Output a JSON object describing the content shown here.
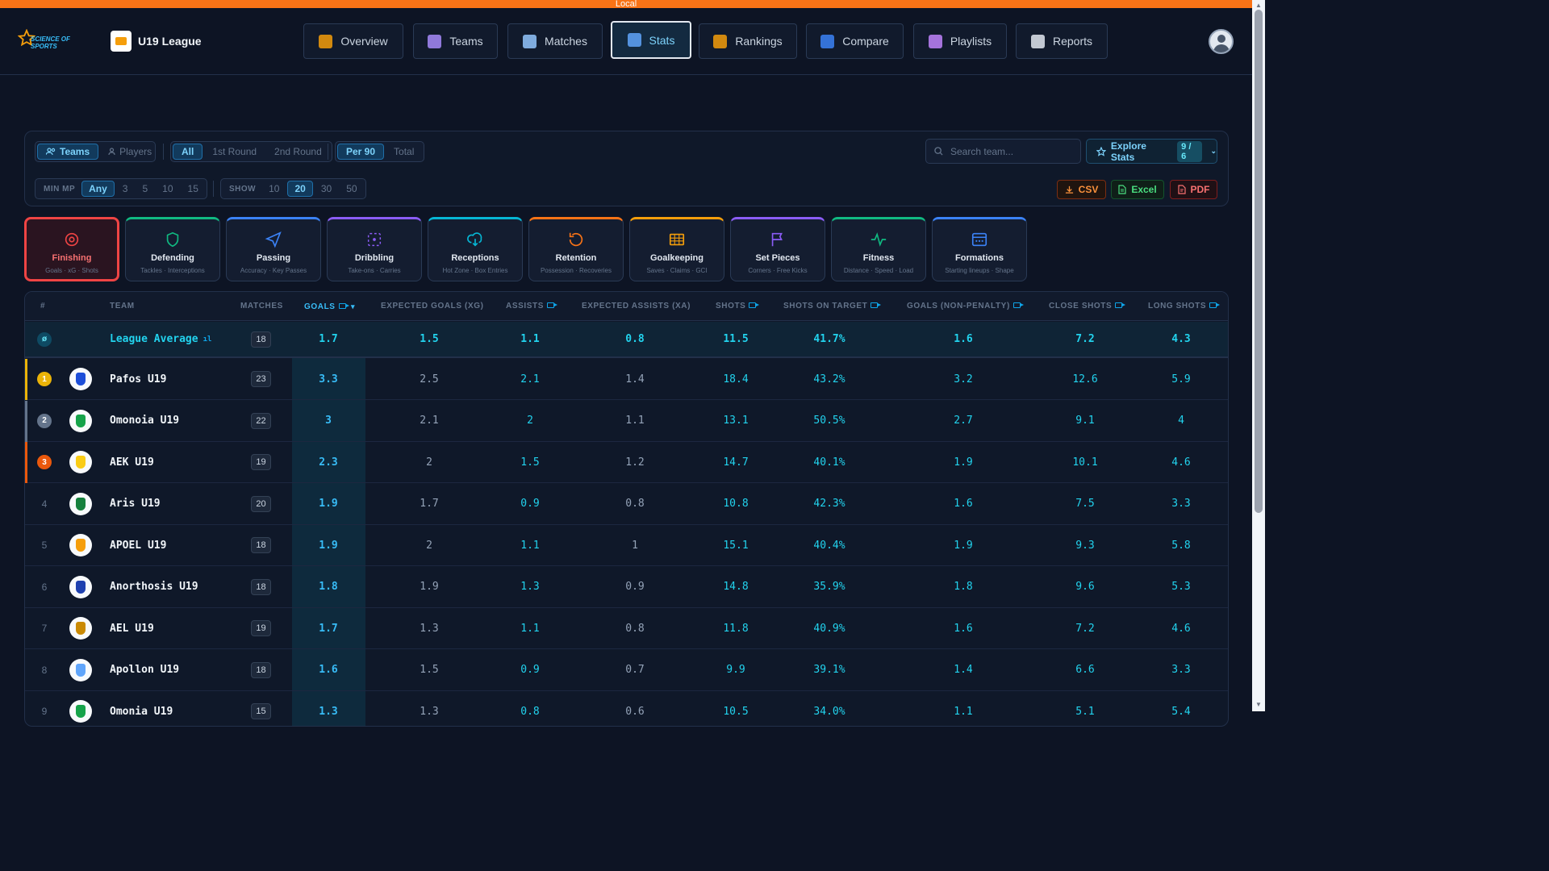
{
  "env_label": "Local",
  "brand": {
    "name": "SCIENCE OF SPORTS"
  },
  "league": {
    "name": "U19 League"
  },
  "nav": [
    {
      "label": "Overview",
      "icon": "chart-icon",
      "color": "#f59e0b"
    },
    {
      "label": "Teams",
      "icon": "users-icon",
      "color": "#a78bfa"
    },
    {
      "label": "Matches",
      "icon": "calendar-icon",
      "color": "#93c5fd"
    },
    {
      "label": "Stats",
      "icon": "trending-icon",
      "color": "#60a5fa",
      "active": true
    },
    {
      "label": "Rankings",
      "icon": "trophy-icon",
      "color": "#f59e0b"
    },
    {
      "label": "Compare",
      "icon": "compare-icon",
      "color": "#3b82f6"
    },
    {
      "label": "Playlists",
      "icon": "video-group-icon",
      "color": "#c084fc"
    },
    {
      "label": "Reports",
      "icon": "document-icon",
      "color": "#e2e8f0"
    }
  ],
  "filters": {
    "entity": [
      "Teams",
      "Players"
    ],
    "round": [
      "All",
      "1st Round",
      "2nd Round"
    ],
    "mode": [
      "Per 90",
      "Total"
    ],
    "min_mp_label": "MIN MP",
    "min_mp": [
      "Any",
      "3",
      "5",
      "10",
      "15"
    ],
    "show_label": "SHOW",
    "show": [
      "10",
      "20",
      "30",
      "50"
    ]
  },
  "search": {
    "placeholder": "Search team..."
  },
  "explore": {
    "label": "Explore Stats",
    "badge": "9 / 6"
  },
  "exports": {
    "csv": "CSV",
    "excel": "Excel",
    "pdf": "PDF"
  },
  "categories": [
    {
      "name": "Finishing",
      "sub": "Goals · xG · Shots",
      "color": "#ef4444",
      "icon": "target-icon",
      "active": true
    },
    {
      "name": "Defending",
      "sub": "Tackles · Interceptions",
      "color": "#10b981",
      "icon": "shield-icon"
    },
    {
      "name": "Passing",
      "sub": "Accuracy · Key Passes",
      "color": "#3b82f6",
      "icon": "send-icon"
    },
    {
      "name": "Dribbling",
      "sub": "Take-ons · Carries",
      "color": "#8b5cf6",
      "icon": "dribble-icon"
    },
    {
      "name": "Receptions",
      "sub": "Hot Zone · Box Entries",
      "color": "#06b6d4",
      "icon": "receive-icon"
    },
    {
      "name": "Retention",
      "sub": "Possession · Recoveries",
      "color": "#f97316",
      "icon": "rotate-icon"
    },
    {
      "name": "Goalkeeping",
      "sub": "Saves · Claims · GCI",
      "color": "#f59e0b",
      "icon": "goal-icon"
    },
    {
      "name": "Set Pieces",
      "sub": "Corners · Free Kicks",
      "color": "#8b5cf6",
      "icon": "flag-icon"
    },
    {
      "name": "Fitness",
      "sub": "Distance · Speed · Load",
      "color": "#10b981",
      "icon": "pulse-icon"
    },
    {
      "name": "Formations",
      "sub": "Starting lineups · Shape",
      "color": "#3b82f6",
      "icon": "formation-icon"
    }
  ],
  "table": {
    "headers": [
      "#",
      "TEAM",
      "MATCHES",
      "GOALS",
      "EXPECTED GOALS (XG)",
      "ASSISTS",
      "EXPECTED ASSISTS (XA)",
      "SHOTS",
      "SHOTS ON TARGET",
      "GOALS (NON-PENALTY)",
      "CLOSE SHOTS",
      "LONG SHOTS"
    ],
    "sort_arrow": "▾",
    "average": {
      "symbol": "ø",
      "team": "League Average",
      "matches": "18",
      "values": [
        "1.7",
        "1.5",
        "1.1",
        "0.8",
        "11.5",
        "41.7%",
        "1.6",
        "7.2",
        "4.3"
      ]
    },
    "rows": [
      {
        "rank": "1",
        "team": "Pafos U19",
        "matches": "23",
        "crest": "#1d4ed8",
        "values": [
          "3.3",
          "2.5",
          "2.1",
          "1.4",
          "18.4",
          "43.2%",
          "3.2",
          "12.6",
          "5.9"
        ]
      },
      {
        "rank": "2",
        "team": "Omonoia U19",
        "matches": "22",
        "crest": "#16a34a",
        "values": [
          "3",
          "2.1",
          "2",
          "1.1",
          "13.1",
          "50.5%",
          "2.7",
          "9.1",
          "4"
        ]
      },
      {
        "rank": "3",
        "team": "AEK U19",
        "matches": "19",
        "crest": "#facc15",
        "values": [
          "2.3",
          "2",
          "1.5",
          "1.2",
          "14.7",
          "40.1%",
          "1.9",
          "10.1",
          "4.6"
        ]
      },
      {
        "rank": "4",
        "team": "Aris U19",
        "matches": "20",
        "crest": "#15803d",
        "values": [
          "1.9",
          "1.7",
          "0.9",
          "0.8",
          "10.8",
          "42.3%",
          "1.6",
          "7.5",
          "3.3"
        ]
      },
      {
        "rank": "5",
        "team": "APOEL U19",
        "matches": "18",
        "crest": "#f59e0b",
        "values": [
          "1.9",
          "2",
          "1.1",
          "1",
          "15.1",
          "40.4%",
          "1.9",
          "9.3",
          "5.8"
        ]
      },
      {
        "rank": "6",
        "team": "Anorthosis U19",
        "matches": "18",
        "crest": "#1e40af",
        "values": [
          "1.8",
          "1.9",
          "1.3",
          "0.9",
          "14.8",
          "35.9%",
          "1.8",
          "9.6",
          "5.3"
        ]
      },
      {
        "rank": "7",
        "team": "AEL U19",
        "matches": "19",
        "crest": "#ca8a04",
        "values": [
          "1.7",
          "1.3",
          "1.1",
          "0.8",
          "11.8",
          "40.9%",
          "1.6",
          "7.2",
          "4.6"
        ]
      },
      {
        "rank": "8",
        "team": "Apollon U19",
        "matches": "18",
        "crest": "#60a5fa",
        "values": [
          "1.6",
          "1.5",
          "0.9",
          "0.7",
          "9.9",
          "39.1%",
          "1.4",
          "6.6",
          "3.3"
        ]
      },
      {
        "rank": "9",
        "team": "Omonia U19",
        "matches": "15",
        "crest": "#16a34a",
        "values": [
          "1.3",
          "1.3",
          "0.8",
          "0.6",
          "10.5",
          "34.0%",
          "1.1",
          "5.1",
          "5.4"
        ]
      }
    ]
  },
  "colors": {
    "accent": "#38bdf8",
    "gold": "#eab308",
    "silver": "#64748b",
    "bronze": "#ea580c"
  }
}
